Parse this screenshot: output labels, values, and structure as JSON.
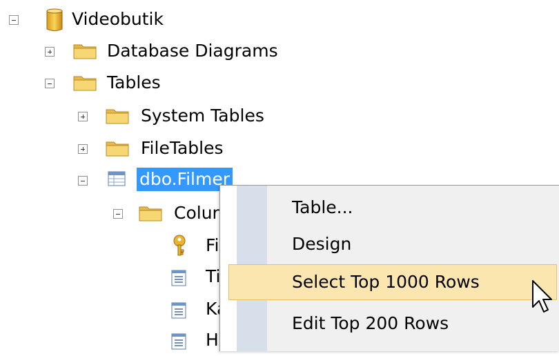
{
  "tree": {
    "root": {
      "label": "Videobutik",
      "icon": "database-icon",
      "expanded": true
    },
    "database_diagrams": {
      "label": "Database Diagrams",
      "icon": "folder-icon",
      "expanded": false
    },
    "tables": {
      "label": "Tables",
      "icon": "folder-icon",
      "expanded": true
    },
    "system_tables": {
      "label": "System Tables",
      "icon": "folder-icon",
      "expanded": false
    },
    "file_tables": {
      "label": "FileTables",
      "icon": "folder-icon",
      "expanded": false
    },
    "table_filmer": {
      "label": "dbo.Filmer",
      "icon": "table-icon",
      "expanded": true,
      "selected": true
    },
    "columns_folder": {
      "label": "Colur",
      "icon": "folder-icon",
      "expanded": true
    },
    "columns": [
      {
        "label": "Fi",
        "icon": "key-icon"
      },
      {
        "label": "Ti",
        "icon": "column-icon"
      },
      {
        "label": "Ka",
        "icon": "column-icon"
      },
      {
        "label": "H",
        "icon": "column-icon"
      }
    ]
  },
  "context_menu": {
    "items": [
      {
        "label": "Table..."
      },
      {
        "label": "Design"
      },
      {
        "label": "Select Top 1000 Rows",
        "highlighted": true
      },
      {
        "label": "Edit Top 200 Rows"
      }
    ]
  },
  "colors": {
    "selection": "#3399ff",
    "menu_hover": "#fce6b0",
    "menu_hover_border": "#e5c365",
    "menu_icon_strip": "#d7dfeb",
    "folder_yellow": "#f5d272"
  }
}
